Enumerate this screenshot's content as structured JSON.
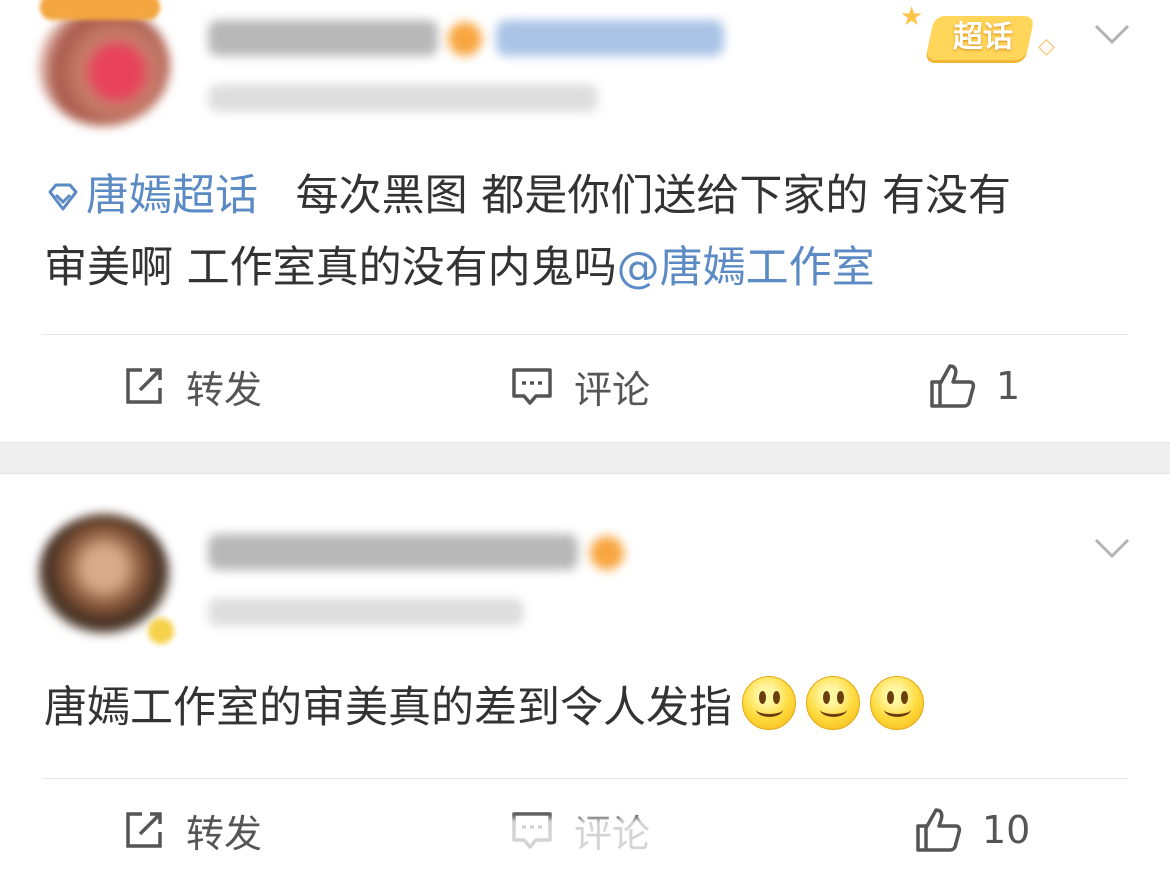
{
  "posts": [
    {
      "content_prefix": "唐嫣超话",
      "content_text": "每次黑图 都是你们送给下家的 有没有",
      "content_line2": "审美啊 工作室真的没有内鬼吗",
      "mention": "@唐嫣工作室",
      "super_topic_badge": "超话",
      "actions": {
        "repost": "转发",
        "comment": "评论",
        "like": "1"
      }
    },
    {
      "content_text": "唐嫣工作室的审美真的差到令人发指",
      "emoji_count": 3,
      "actions": {
        "repost": "转发",
        "comment": "评论",
        "like": "10"
      }
    }
  ],
  "colors": {
    "link": "#5b8ac4",
    "text": "#333333",
    "separator": "#efefef"
  },
  "icons": [
    "repost-icon",
    "comment-icon",
    "like-icon",
    "chevron-down-icon",
    "super-topic-icon",
    "smile-emoji"
  ]
}
